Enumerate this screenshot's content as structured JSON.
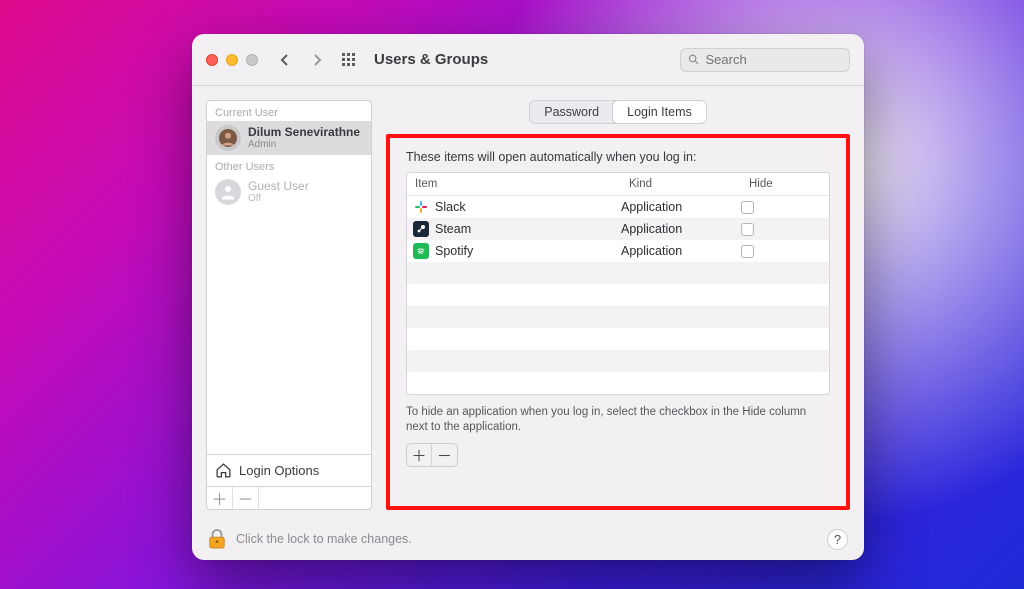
{
  "window": {
    "title": "Users & Groups"
  },
  "search": {
    "placeholder": "Search"
  },
  "sidebar": {
    "current_label": "Current User",
    "other_label": "Other Users",
    "current_user": {
      "name": "Dilum Senevirathne",
      "role": "Admin"
    },
    "guest_user": {
      "name": "Guest User",
      "role": "Off"
    },
    "login_options_label": "Login Options"
  },
  "tabs": {
    "password": "Password",
    "login_items": "Login Items"
  },
  "panel": {
    "intro": "These items will open automatically when you log in:",
    "columns": {
      "item": "Item",
      "kind": "Kind",
      "hide": "Hide"
    },
    "rows": [
      {
        "name": "Slack",
        "kind": "Application",
        "icon": "slack",
        "hide": false
      },
      {
        "name": "Steam",
        "kind": "Application",
        "icon": "steam",
        "hide": false
      },
      {
        "name": "Spotify",
        "kind": "Application",
        "icon": "spotify",
        "hide": false
      }
    ],
    "hint": "To hide an application when you log in, select the checkbox in the Hide column next to the application."
  },
  "footer": {
    "lock_text": "Click the lock to make changes."
  }
}
